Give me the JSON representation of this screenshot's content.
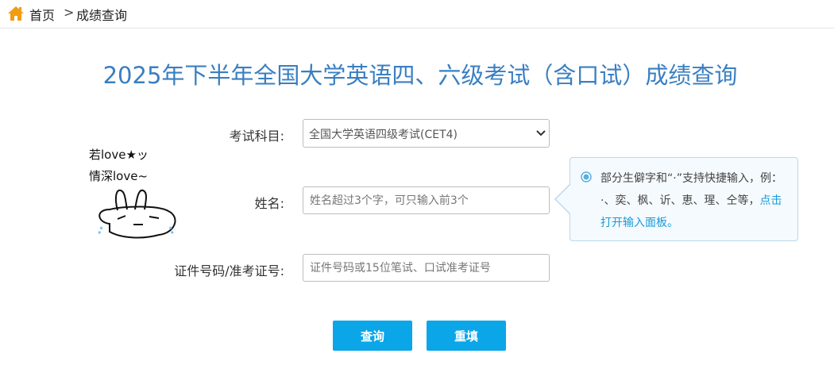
{
  "breadcrumb": {
    "home_label": "首页",
    "separator": ">",
    "current_label": "成绩查询",
    "home_icon": "home-icon",
    "home_icon_color": "#f39c12"
  },
  "page": {
    "title": "2025年下半年全国大学英语四、六级考试（含口试）成绩查询",
    "title_color": "#3a7fc1"
  },
  "form": {
    "subject": {
      "label": "考试科目:",
      "selected": "全国大学英语四级考试(CET4)"
    },
    "name": {
      "label": "姓名:",
      "placeholder": "姓名超过3个字，可只输入前3个",
      "value": ""
    },
    "id_number": {
      "label": "证件号码/准考证号:",
      "placeholder": "证件号码或15位笔试、口试准考证号",
      "value": ""
    }
  },
  "tooltip": {
    "text": "部分生僻字和“·”支持快捷输入，例：·、奕、枫、䜣、恵、瑆、仝等，",
    "link_text": "点击打开输入面板。",
    "link_color": "#1a9bd6"
  },
  "buttons": {
    "query_label": "查询",
    "reset_label": "重填",
    "color": "#0aa6e8"
  },
  "doodle": {
    "line1": "若love★ッ",
    "line2": "情深love~"
  }
}
